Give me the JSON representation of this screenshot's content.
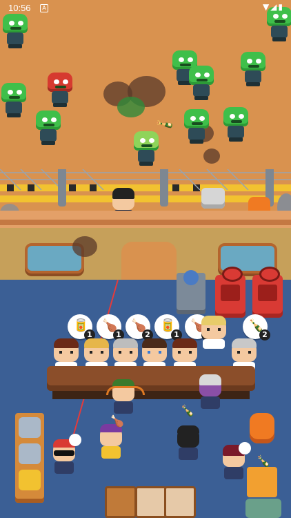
{
  "status_bar": {
    "time": "10:56",
    "notification_icon": "A",
    "signal_icons": "▼◢▮"
  },
  "colors": {
    "dirt": "#d9924f",
    "floor": "#3b5f95",
    "zombie": "#3fbf4a",
    "counter": "#8b4e2a",
    "machine": "#d93a34"
  },
  "orders": [
    {
      "item": "soda-can-icon",
      "glyph": "🥫",
      "count": "1"
    },
    {
      "item": "drumstick-icon",
      "glyph": "🍗",
      "count": "1"
    },
    {
      "item": "drumstick-icon",
      "glyph": "🍗",
      "count": "2"
    },
    {
      "item": "soda-can-icon",
      "glyph": "🥫",
      "count": "1"
    },
    {
      "item": "drumstick-icon",
      "glyph": "🍗",
      "count": "2"
    },
    {
      "item": "bottle-icon",
      "glyph": "🍾",
      "count": "2"
    }
  ],
  "zombies_count_visible": 12
}
